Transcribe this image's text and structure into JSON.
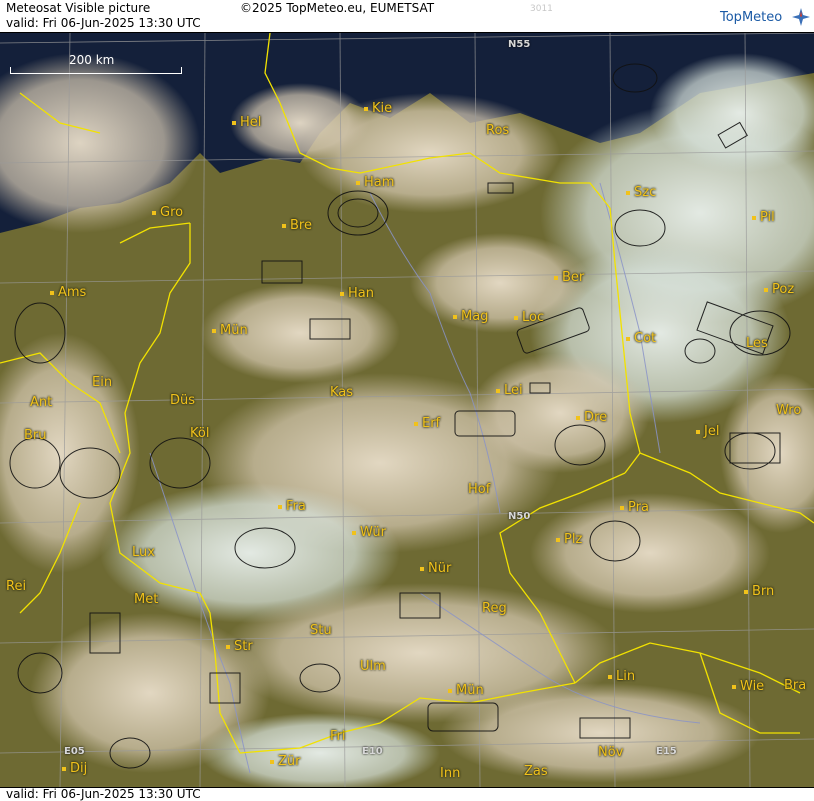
{
  "header": {
    "product": "Meteosat Visible picture",
    "copyright": "©2025 TopMeteo.eu, EUMETSAT",
    "faint_code": "3011",
    "valid": "valid:  Fri  06-Jun-2025  13:30 UTC",
    "logo_text": "TopMeteo"
  },
  "footer": {
    "valid": "valid:  Fri  06-Jun-2025  13:30 UTC"
  },
  "scale_bar": {
    "label": "200 km"
  },
  "grid_labels": {
    "n55": "N55",
    "n50": "N50",
    "e05": "E05",
    "e10": "E10",
    "e15": "E15"
  },
  "cities": [
    {
      "name": "Hel"
    },
    {
      "name": "Kie"
    },
    {
      "name": "Ros"
    },
    {
      "name": "Ham"
    },
    {
      "name": "Szc"
    },
    {
      "name": "Gro"
    },
    {
      "name": "Bre"
    },
    {
      "name": "Pil"
    },
    {
      "name": "Ber"
    },
    {
      "name": "Ams"
    },
    {
      "name": "Han"
    },
    {
      "name": "Poz"
    },
    {
      "name": "Mün"
    },
    {
      "name": "Mag"
    },
    {
      "name": "Loc"
    },
    {
      "name": "Cot"
    },
    {
      "name": "Les"
    },
    {
      "name": "Ein"
    },
    {
      "name": "Kas"
    },
    {
      "name": "Lei"
    },
    {
      "name": "Ant"
    },
    {
      "name": "Düs"
    },
    {
      "name": "Dre"
    },
    {
      "name": "Wro"
    },
    {
      "name": "Bru"
    },
    {
      "name": "Köl"
    },
    {
      "name": "Erf"
    },
    {
      "name": "Jel"
    },
    {
      "name": "Hof"
    },
    {
      "name": "Fra"
    },
    {
      "name": "Pra"
    },
    {
      "name": "Wür"
    },
    {
      "name": "Plz"
    },
    {
      "name": "Lux"
    },
    {
      "name": "Nür"
    },
    {
      "name": "Rei"
    },
    {
      "name": "Met"
    },
    {
      "name": "Reg"
    },
    {
      "name": "Brn"
    },
    {
      "name": "Stu"
    },
    {
      "name": "Str"
    },
    {
      "name": "Ulm"
    },
    {
      "name": "Lin"
    },
    {
      "name": "Mün"
    },
    {
      "name": "Wie"
    },
    {
      "name": "Bra"
    },
    {
      "name": "Fri"
    },
    {
      "name": "Dij"
    },
    {
      "name": "Zür"
    },
    {
      "name": "Inn"
    },
    {
      "name": "Zas"
    },
    {
      "name": "Növ"
    }
  ],
  "colors": {
    "land": "#6f6a2c",
    "cloud": "#ddd2bf",
    "sea": "#0f1a2e",
    "border": "#f2e200",
    "city_label": "#f1c21b",
    "river": "#8a93c8",
    "logo": "#1b5aa5"
  }
}
